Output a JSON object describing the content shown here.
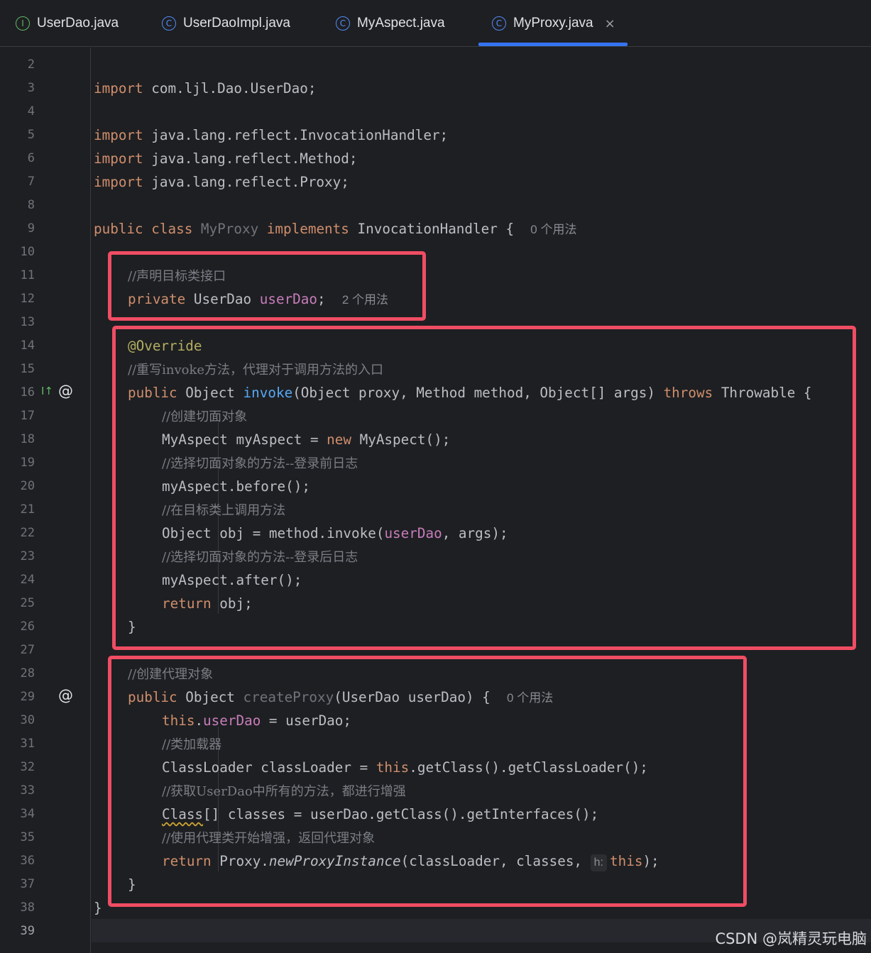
{
  "tabs": [
    {
      "label": "UserDao.java",
      "icon": "interface-icon",
      "active": false
    },
    {
      "label": "UserDaoImpl.java",
      "icon": "class-icon",
      "active": false
    },
    {
      "label": "MyAspect.java",
      "icon": "class-icon",
      "active": false
    },
    {
      "label": "MyProxy.java",
      "icon": "class-icon",
      "active": true,
      "close": "×"
    }
  ],
  "icon_glyphs": {
    "interface": "I",
    "class": "C",
    "override_marker": "I↑",
    "at_marker": "@"
  },
  "line_numbers": [
    "2",
    "3",
    "4",
    "5",
    "6",
    "7",
    "8",
    "9",
    "10",
    "11",
    "12",
    "13",
    "14",
    "15",
    "16",
    "17",
    "18",
    "19",
    "20",
    "21",
    "22",
    "23",
    "24",
    "25",
    "26",
    "27",
    "28",
    "29",
    "30",
    "31",
    "32",
    "33",
    "34",
    "35",
    "36",
    "37",
    "38",
    "39"
  ],
  "current_line": "39",
  "code": {
    "l3": {
      "kw": "import",
      "rest": " com.ljl.Dao.UserDao;"
    },
    "l5": {
      "kw": "import",
      "rest": " java.lang.reflect.InvocationHandler;"
    },
    "l6": {
      "kw": "import",
      "rest": " java.lang.reflect.Method;"
    },
    "l7": {
      "kw": "import",
      "rest": " java.lang.reflect.Proxy;"
    },
    "l9": {
      "kw1": "public class",
      "name": " MyProxy",
      "kw2": " implements",
      "rest": " InvocationHandler {",
      "usage": "0 个用法"
    },
    "l11": {
      "comment": "//声明目标类接口"
    },
    "l12": {
      "kw": "private",
      "type": " UserDao ",
      "field": "userDao",
      "semi": ";",
      "usage": "2 个用法"
    },
    "l14": {
      "ann": "@Override"
    },
    "l15": {
      "comment": "//重写invoke方法，代理对于调用方法的入口"
    },
    "l16": {
      "kw": "public",
      "p1": " Object ",
      "fn": "invoke",
      "p2": "(Object proxy, Method method, Object[] args) ",
      "kw2": "throws",
      "p3": " Throwable {"
    },
    "l17": {
      "comment": "//创建切面对象"
    },
    "l18": {
      "p1": "MyAspect myAspect = ",
      "kw": "new",
      "p2": " MyAspect();"
    },
    "l19": {
      "comment": "//选择切面对象的方法--登录前日志"
    },
    "l20": {
      "text": "myAspect.before();"
    },
    "l21": {
      "comment": "//在目标类上调用方法"
    },
    "l22": {
      "p1": "Object obj = method.invoke(",
      "field": "userDao",
      "p2": ", args);"
    },
    "l23": {
      "comment": "//选择切面对象的方法--登录后日志"
    },
    "l24": {
      "text": "myAspect.after();"
    },
    "l25": {
      "kw": "return",
      "rest": " obj;"
    },
    "l26": {
      "text": "}"
    },
    "l28": {
      "comment": "//创建代理对象"
    },
    "l29": {
      "kw": "public",
      "p1": " Object ",
      "name": "createProxy",
      "p2": "(UserDao userDao) {",
      "usage": "0 个用法"
    },
    "l30": {
      "kw": "this",
      "dot": ".",
      "field": "userDao",
      "rest": " = userDao;"
    },
    "l31": {
      "comment": "//类加载器"
    },
    "l32": {
      "p1": "ClassLoader classLoader = ",
      "kw": "this",
      "p2": ".getClass().getClassLoader();"
    },
    "l33": {
      "comment": "//获取UserDao中所有的方法，都进行增强"
    },
    "l34": {
      "wavy": "Class",
      "rest": "[] classes = userDao.getClass().getInterfaces();"
    },
    "l35": {
      "comment": "//使用代理类开始增强，返回代理对象"
    },
    "l36": {
      "kw": "return",
      "p1": " Proxy.",
      "ital": "newProxyInstance",
      "p2": "(classLoader, classes, ",
      "hint": "h:",
      "kw2": "this",
      "p3": ");"
    },
    "l37": {
      "text": "}"
    },
    "l38": {
      "text": "}"
    }
  },
  "watermark": "CSDN @岚精灵玩电脑",
  "colors": {
    "highlight_box": "#ef4d63",
    "keyword": "#cf8e6d",
    "field": "#c77dbb",
    "function": "#56a8f5",
    "annotation": "#b3ae60",
    "comment": "#7a7e85",
    "tab_underline": "#3574f0"
  }
}
